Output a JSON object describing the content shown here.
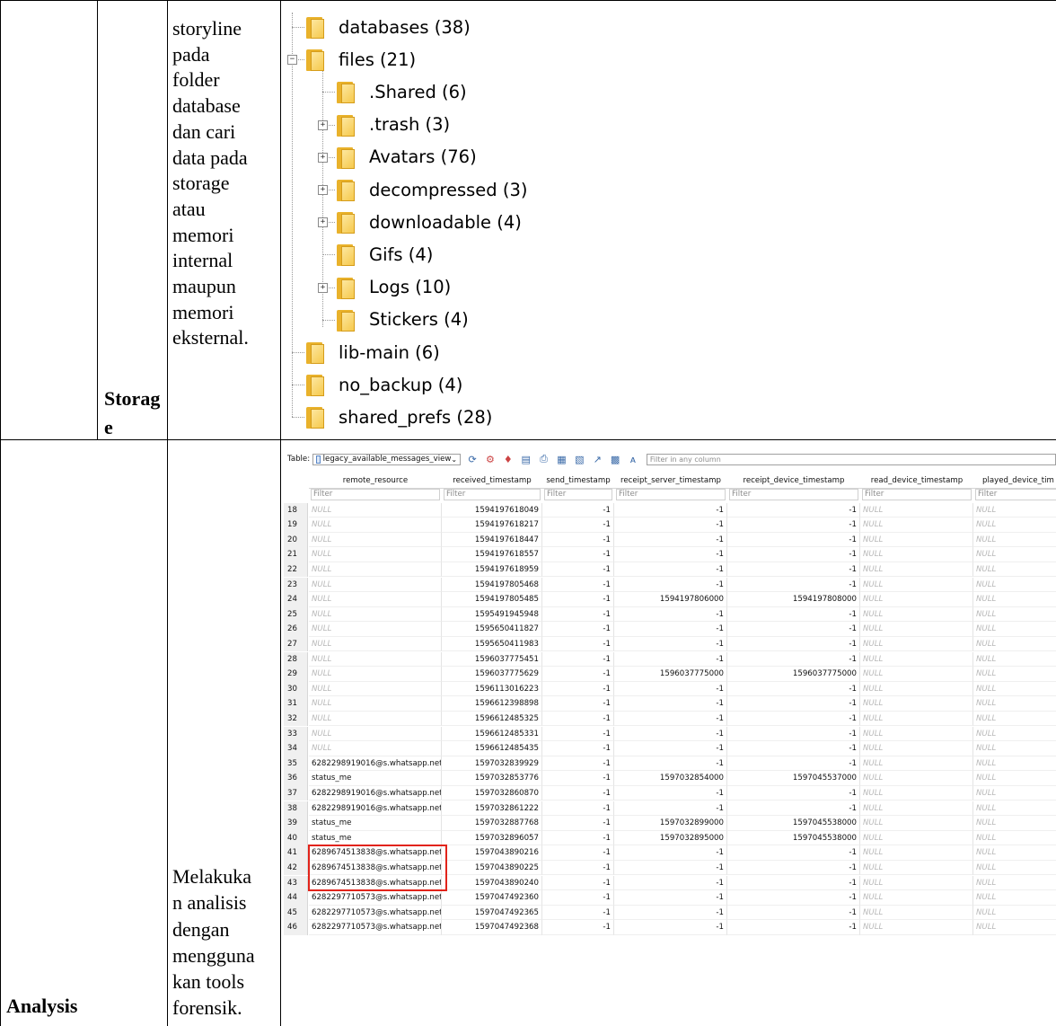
{
  "storage_row": {
    "label_line1": "Storag",
    "label_line2": "e",
    "description_lines": [
      "storyline",
      "pada",
      "folder",
      "database",
      "dan cari",
      "data pada",
      "storage",
      "atau",
      "memori",
      "internal",
      "maupun",
      "memori",
      "eksternal."
    ],
    "tree": [
      {
        "name": "databases (38)",
        "level": 0,
        "expander": ""
      },
      {
        "name": "files (21)",
        "level": 0,
        "expander": "-"
      },
      {
        "name": ".Shared (6)",
        "level": 1,
        "expander": ""
      },
      {
        "name": ".trash (3)",
        "level": 1,
        "expander": "+"
      },
      {
        "name": "Avatars (76)",
        "level": 1,
        "expander": "+"
      },
      {
        "name": "decompressed (3)",
        "level": 1,
        "expander": "+"
      },
      {
        "name": "downloadable (4)",
        "level": 1,
        "expander": "+"
      },
      {
        "name": "Gifs (4)",
        "level": 1,
        "expander": ""
      },
      {
        "name": "Logs (10)",
        "level": 1,
        "expander": "+"
      },
      {
        "name": "Stickers (4)",
        "level": 1,
        "expander": ""
      },
      {
        "name": "lib-main (6)",
        "level": 0,
        "expander": ""
      },
      {
        "name": "no_backup (4)",
        "level": 0,
        "expander": ""
      },
      {
        "name": "shared_prefs (28)",
        "level": 0,
        "expander": ""
      }
    ]
  },
  "analysis_row": {
    "label": "Analysis",
    "description_lines": [
      "Melakuka",
      "n analisis",
      "dengan",
      "mengguna",
      "kan tools",
      "forensik."
    ],
    "db_browser": {
      "table_label": "Table:",
      "table_name": "legacy_available_messages_view",
      "filter_placeholder": "Filter in any column",
      "columns": [
        "remote_resource",
        "received_timestamp",
        "send_timestamp",
        "receipt_server_timestamp",
        "receipt_device_timestamp",
        "read_device_timestamp",
        "played_device_tim"
      ],
      "column_filter_placeholder": "Filter",
      "null_text": "NULL",
      "rows": [
        [
          "18",
          "NULL",
          "1594197618049",
          "-1",
          "-1",
          "-1",
          "NULL",
          "NULL"
        ],
        [
          "19",
          "NULL",
          "1594197618217",
          "-1",
          "-1",
          "-1",
          "NULL",
          "NULL"
        ],
        [
          "20",
          "NULL",
          "1594197618447",
          "-1",
          "-1",
          "-1",
          "NULL",
          "NULL"
        ],
        [
          "21",
          "NULL",
          "1594197618557",
          "-1",
          "-1",
          "-1",
          "NULL",
          "NULL"
        ],
        [
          "22",
          "NULL",
          "1594197618959",
          "-1",
          "-1",
          "-1",
          "NULL",
          "NULL"
        ],
        [
          "23",
          "NULL",
          "1594197805468",
          "-1",
          "-1",
          "-1",
          "NULL",
          "NULL"
        ],
        [
          "24",
          "NULL",
          "1594197805485",
          "-1",
          "1594197806000",
          "1594197808000",
          "NULL",
          "NULL"
        ],
        [
          "25",
          "NULL",
          "1595491945948",
          "-1",
          "-1",
          "-1",
          "NULL",
          "NULL"
        ],
        [
          "26",
          "NULL",
          "1595650411827",
          "-1",
          "-1",
          "-1",
          "NULL",
          "NULL"
        ],
        [
          "27",
          "NULL",
          "1595650411983",
          "-1",
          "-1",
          "-1",
          "NULL",
          "NULL"
        ],
        [
          "28",
          "NULL",
          "1596037775451",
          "-1",
          "-1",
          "-1",
          "NULL",
          "NULL"
        ],
        [
          "29",
          "NULL",
          "1596037775629",
          "-1",
          "1596037775000",
          "1596037775000",
          "NULL",
          "NULL"
        ],
        [
          "30",
          "NULL",
          "1596113016223",
          "-1",
          "-1",
          "-1",
          "NULL",
          "NULL"
        ],
        [
          "31",
          "NULL",
          "1596612398898",
          "-1",
          "-1",
          "-1",
          "NULL",
          "NULL"
        ],
        [
          "32",
          "NULL",
          "1596612485325",
          "-1",
          "-1",
          "-1",
          "NULL",
          "NULL"
        ],
        [
          "33",
          "NULL",
          "1596612485331",
          "-1",
          "-1",
          "-1",
          "NULL",
          "NULL"
        ],
        [
          "34",
          "NULL",
          "1596612485435",
          "-1",
          "-1",
          "-1",
          "NULL",
          "NULL"
        ],
        [
          "35",
          "6282298919016@s.whatsapp.net",
          "1597032839929",
          "-1",
          "-1",
          "-1",
          "NULL",
          "NULL"
        ],
        [
          "36",
          "status_me",
          "1597032853776",
          "-1",
          "1597032854000",
          "1597045537000",
          "NULL",
          "NULL"
        ],
        [
          "37",
          "6282298919016@s.whatsapp.net",
          "1597032860870",
          "-1",
          "-1",
          "-1",
          "NULL",
          "NULL"
        ],
        [
          "38",
          "6282298919016@s.whatsapp.net",
          "1597032861222",
          "-1",
          "-1",
          "-1",
          "NULL",
          "NULL"
        ],
        [
          "39",
          "status_me",
          "1597032887768",
          "-1",
          "1597032899000",
          "1597045538000",
          "NULL",
          "NULL"
        ],
        [
          "40",
          "status_me",
          "1597032896057",
          "-1",
          "1597032895000",
          "1597045538000",
          "NULL",
          "NULL"
        ],
        [
          "41",
          "6289674513838@s.whatsapp.net",
          "1597043890216",
          "-1",
          "-1",
          "-1",
          "NULL",
          "NULL"
        ],
        [
          "42",
          "6289674513838@s.whatsapp.net",
          "1597043890225",
          "-1",
          "-1",
          "-1",
          "NULL",
          "NULL"
        ],
        [
          "43",
          "6289674513838@s.whatsapp.net",
          "1597043890240",
          "-1",
          "-1",
          "-1",
          "NULL",
          "NULL"
        ],
        [
          "44",
          "6282297710573@s.whatsapp.net",
          "1597047492360",
          "-1",
          "-1",
          "-1",
          "NULL",
          "NULL"
        ],
        [
          "45",
          "6282297710573@s.whatsapp.net",
          "1597047492365",
          "-1",
          "-1",
          "-1",
          "NULL",
          "NULL"
        ],
        [
          "46",
          "6282297710573@s.whatsapp.net",
          "1597047492368",
          "-1",
          "-1",
          "-1",
          "NULL",
          "NULL"
        ]
      ],
      "highlight_rows": [
        "41",
        "42",
        "43"
      ],
      "highlight_color": "#e2231a"
    }
  }
}
